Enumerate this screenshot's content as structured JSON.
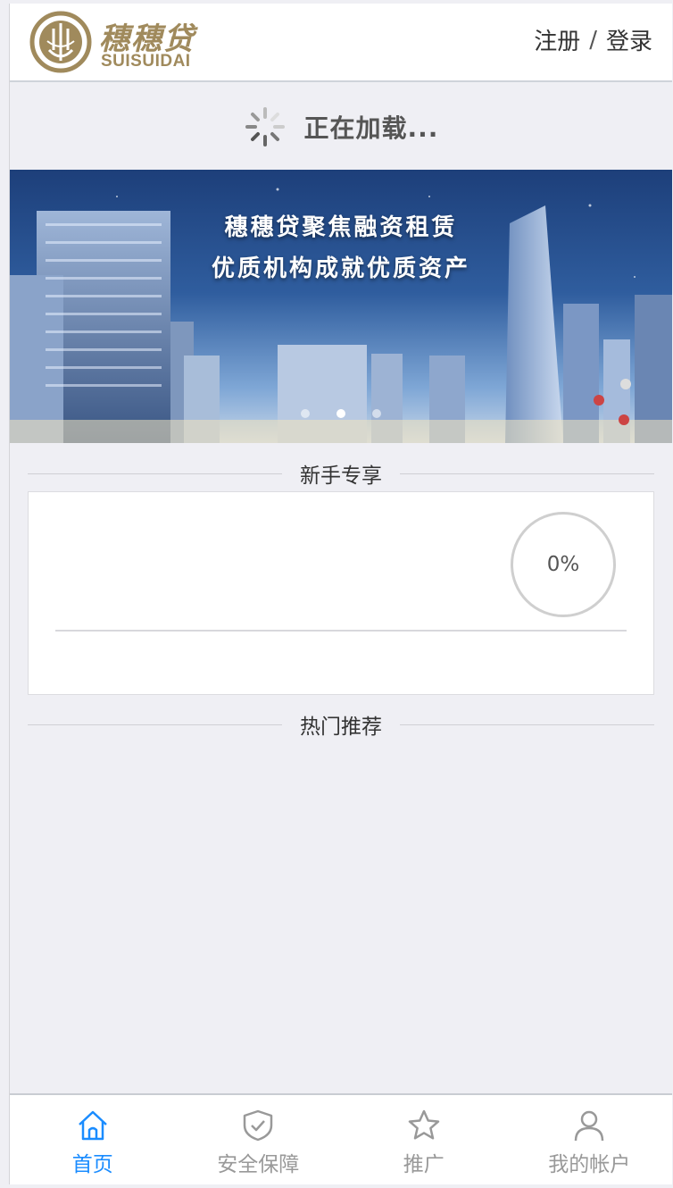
{
  "header": {
    "logo_cn": "穗穗贷",
    "logo_en": "SUISUIDAI",
    "register_label": "注册",
    "separator": "/",
    "login_label": "登录"
  },
  "loading": {
    "text": "正在加载..."
  },
  "banner": {
    "line1": "穗穗贷聚焦融资租赁",
    "line2": "优质机构成就优质资产",
    "slides": 3,
    "active_slide": 2
  },
  "sections": {
    "newbie_title": "新手专享",
    "hot_title": "热门推荐"
  },
  "newbie_card": {
    "progress_text": "0%",
    "progress": 0
  },
  "tabbar": {
    "items": [
      {
        "label": "首页",
        "icon": "home-icon",
        "active": true
      },
      {
        "label": "安全保障",
        "icon": "shield-check-icon",
        "active": false
      },
      {
        "label": "推广",
        "icon": "star-icon",
        "active": false
      },
      {
        "label": "我的帐户",
        "icon": "user-icon",
        "active": false
      }
    ]
  },
  "colors": {
    "accent": "#1a8cff",
    "brand_gold": "#a08a5c",
    "background": "#efeff4"
  }
}
